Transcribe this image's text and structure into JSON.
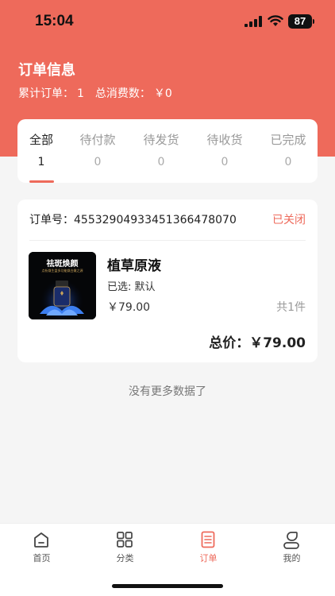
{
  "status_bar": {
    "time": "15:04",
    "battery": "87"
  },
  "header": {
    "title": "订单信息",
    "total_orders_label": "累计订单：",
    "total_orders_value": "1",
    "total_spent_label": "总消费数：",
    "total_spent_value": "￥0"
  },
  "tabs": [
    {
      "label": "全部",
      "count": "1",
      "active": true
    },
    {
      "label": "待付款",
      "count": "0",
      "active": false
    },
    {
      "label": "待发货",
      "count": "0",
      "active": false
    },
    {
      "label": "待收货",
      "count": "0",
      "active": false
    },
    {
      "label": "已完成",
      "count": "0",
      "active": false
    }
  ],
  "order": {
    "order_no_label": "订单号：",
    "order_no": "45532904933451366478070",
    "status": "已关闭",
    "thumbnail_title": "祛斑焕颜",
    "thumbnail_subtitle": "点析焕生盘多功能焕白嫩之源",
    "product_name": "植草原液",
    "spec": "已选: 默认",
    "price": "￥79.00",
    "quantity": "共1件",
    "total_label": "总价：",
    "total_value": "￥79.00"
  },
  "no_more_text": "没有更多数据了",
  "tabbar": [
    {
      "label": "首页",
      "icon": "home-icon",
      "active": false
    },
    {
      "label": "分类",
      "icon": "grid-icon",
      "active": false
    },
    {
      "label": "订单",
      "icon": "order-document-icon",
      "active": true
    },
    {
      "label": "我的",
      "icon": "profile-icon",
      "active": false
    }
  ],
  "colors": {
    "accent": "#ee6a5b",
    "background": "#f5f5f5"
  }
}
